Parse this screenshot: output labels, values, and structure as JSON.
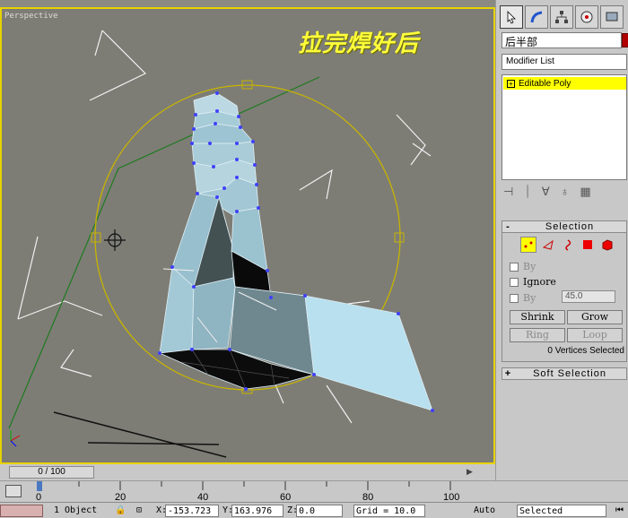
{
  "viewport": {
    "label": "Perspective",
    "annotation": "拉完焊好后"
  },
  "panel": {
    "object_name": "后半部",
    "modifier_list_label": "Modifier List",
    "stack_item": "Editable Poly",
    "selection": {
      "title": "Selection",
      "by_vertex_label": "By",
      "ignore_label": "Ignore",
      "by_angle_label": "By",
      "angle_value": "45.0",
      "shrink_label": "Shrink",
      "grow_label": "Grow",
      "ring_label": "Ring",
      "loop_label": "Loop",
      "status": "0 Vertices Selected"
    },
    "soft_selection_title": "Soft Selection"
  },
  "timeline": {
    "frame_readout": "0 / 100",
    "ticks": [
      "0",
      "20",
      "40",
      "60",
      "80",
      "100"
    ]
  },
  "statusbar": {
    "objects": "1 Object",
    "x_label": "X:",
    "x_value": "-153.723",
    "y_label": "Y:",
    "y_value": "163.976",
    "z_label": "Z:",
    "z_value": "0.0",
    "grid": "Grid = 10.0",
    "auto_key": "Auto Key",
    "selected": "Selected"
  },
  "colors": {
    "viewport_bg": "#7d7d76",
    "active_border": "#e8d200",
    "gizmo": "#c8b400",
    "mesh_face": "#a6ccd8",
    "vertex": "#4040ff"
  }
}
